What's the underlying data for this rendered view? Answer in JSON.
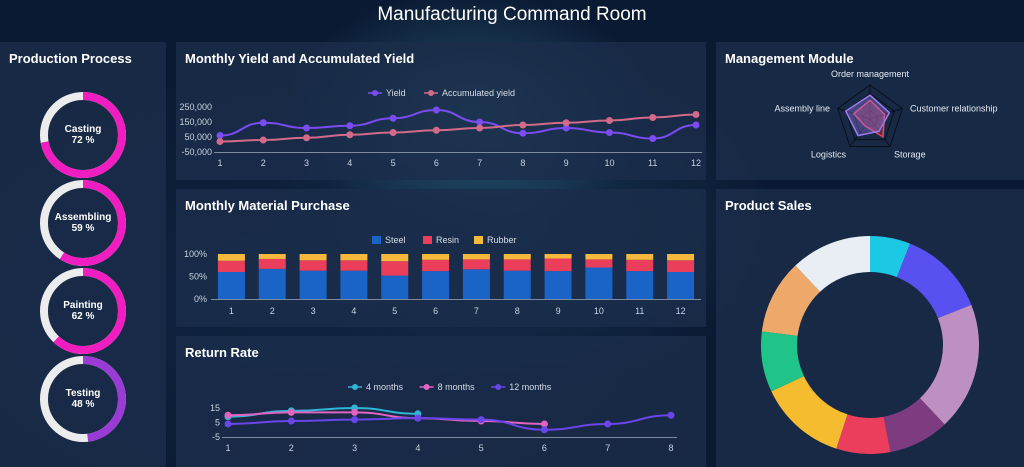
{
  "page": {
    "title": "Manufacturing Command Room"
  },
  "colors": {
    "background": "#0b1a33",
    "panel": "#1b2d4a"
  },
  "production": {
    "title": "Production Process",
    "items": [
      {
        "name": "Casting",
        "percent_label": "72 %",
        "value": 72,
        "color": "#f01ec0"
      },
      {
        "name": "Assembling",
        "percent_label": "59 %",
        "value": 59,
        "color": "#f01ec0"
      },
      {
        "name": "Painting",
        "percent_label": "62 %",
        "value": 62,
        "color": "#f01ec0"
      },
      {
        "name": "Testing",
        "percent_label": "48 %",
        "value": 48,
        "color": "#9a3bd6"
      }
    ]
  },
  "yield_panel": {
    "title": "Monthly Yield and Accumulated Yield"
  },
  "purchase_panel": {
    "title": "Monthly Material Purchase"
  },
  "return_panel": {
    "title": "Return Rate"
  },
  "management_panel": {
    "title": "Management Module"
  },
  "sales_panel": {
    "title": "Product Sales"
  },
  "chart_data": [
    {
      "id": "yield",
      "type": "line",
      "x": [
        1,
        2,
        3,
        4,
        5,
        6,
        7,
        8,
        9,
        10,
        11,
        12
      ],
      "ylim": [
        -50000,
        250000
      ],
      "yticks": [
        "250,000",
        "150,000",
        "50,000",
        "-50,000"
      ],
      "ytick_values": [
        250000,
        150000,
        50000,
        -50000
      ],
      "series": [
        {
          "name": "Yield",
          "color": "#7b4cf2",
          "values": [
            60000,
            145000,
            110000,
            125000,
            175000,
            230000,
            150000,
            75000,
            110000,
            80000,
            40000,
            130000
          ]
        },
        {
          "name": "Accumulated yield",
          "color": "#d36a8a",
          "values": [
            20000,
            30000,
            45000,
            65000,
            80000,
            95000,
            110000,
            130000,
            145000,
            160000,
            180000,
            200000
          ]
        }
      ]
    },
    {
      "id": "purchase",
      "type": "bar",
      "stacked": true,
      "categories": [
        "1",
        "2",
        "3",
        "4",
        "5",
        "6",
        "7",
        "8",
        "9",
        "10",
        "11",
        "12"
      ],
      "yticks": [
        "100%",
        "50%",
        "0%"
      ],
      "series": [
        {
          "name": "Steel",
          "color": "#1a64c7",
          "values": [
            60,
            67,
            63,
            63,
            52,
            62,
            66,
            63,
            62,
            70,
            62,
            60
          ]
        },
        {
          "name": "Resin",
          "color": "#ea3e5a",
          "values": [
            25,
            22,
            23,
            23,
            32,
            25,
            22,
            25,
            28,
            18,
            25,
            26
          ]
        },
        {
          "name": "Rubber",
          "color": "#f6b93b",
          "values": [
            15,
            11,
            14,
            14,
            16,
            13,
            12,
            12,
            10,
            12,
            13,
            14
          ]
        }
      ]
    },
    {
      "id": "return",
      "type": "line",
      "x": [
        1,
        2,
        3,
        4,
        5,
        6,
        7,
        8
      ],
      "ylim": [
        -5,
        15
      ],
      "yticks": [
        "15",
        "5",
        "-5"
      ],
      "ytick_values": [
        15,
        5,
        -5
      ],
      "series": [
        {
          "name": "4 months",
          "color": "#2fb5d6",
          "values": [
            9,
            13,
            15,
            11
          ]
        },
        {
          "name": "8 months",
          "color": "#e263c0",
          "values": [
            10,
            12,
            12,
            8,
            6,
            4
          ]
        },
        {
          "name": "12 months",
          "color": "#6a45e8",
          "values": [
            4,
            6,
            7,
            8,
            7,
            0,
            4,
            10
          ]
        }
      ]
    },
    {
      "id": "management",
      "type": "radar",
      "indicators": [
        "Order management",
        "Customer relationship",
        "Storage",
        "Logistics",
        "Assembly line"
      ],
      "series": [
        {
          "color": "#e2475f",
          "values": [
            0.55,
            0.45,
            0.65,
            0.25,
            0.5
          ]
        },
        {
          "color": "#9b7cf0",
          "values": [
            0.7,
            0.6,
            0.45,
            0.6,
            0.75
          ]
        }
      ]
    },
    {
      "id": "sales",
      "type": "pie",
      "donut": true,
      "values": [
        6,
        13,
        19,
        9,
        8,
        13,
        9,
        11,
        12
      ],
      "colors": [
        "#1cc8e3",
        "#5850f0",
        "#bd8fc2",
        "#7e3c80",
        "#eb3e5d",
        "#f5bc2f",
        "#20c489",
        "#eda86a",
        "#e8eef4"
      ]
    }
  ]
}
